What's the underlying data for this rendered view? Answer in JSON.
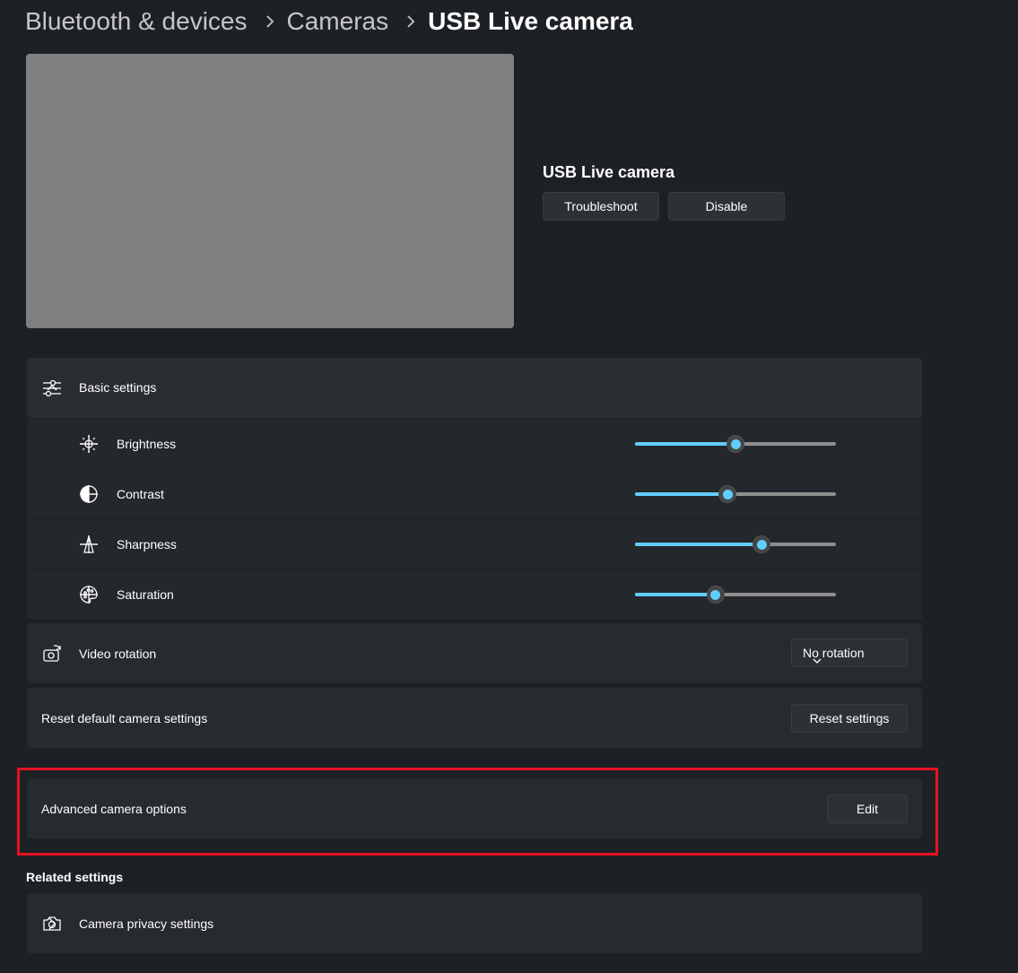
{
  "breadcrumb": {
    "items": [
      "Bluetooth & devices",
      "Cameras",
      "USB  Live camera"
    ]
  },
  "device": {
    "name": "USB  Live camera",
    "troubleshoot_label": "Troubleshoot",
    "disable_label": "Disable"
  },
  "basic_settings": {
    "title": "Basic settings",
    "expanded": true,
    "sliders": [
      {
        "label": "Brightness",
        "icon": "sun-icon",
        "value": 50
      },
      {
        "label": "Contrast",
        "icon": "contrast-icon",
        "value": 46
      },
      {
        "label": "Sharpness",
        "icon": "sharpness-icon",
        "value": 63
      },
      {
        "label": "Saturation",
        "icon": "palette-icon",
        "value": 40
      }
    ]
  },
  "video_rotation": {
    "label": "Video rotation",
    "selected": "No rotation"
  },
  "reset": {
    "label": "Reset default camera settings",
    "button_label": "Reset settings"
  },
  "advanced": {
    "label": "Advanced camera options",
    "button_label": "Edit"
  },
  "related": {
    "title": "Related settings",
    "privacy_label": "Camera privacy settings"
  },
  "colors": {
    "background": "#1d2125",
    "card": "#272a2e",
    "accent": "#60cdff",
    "highlight": "#e81123"
  }
}
